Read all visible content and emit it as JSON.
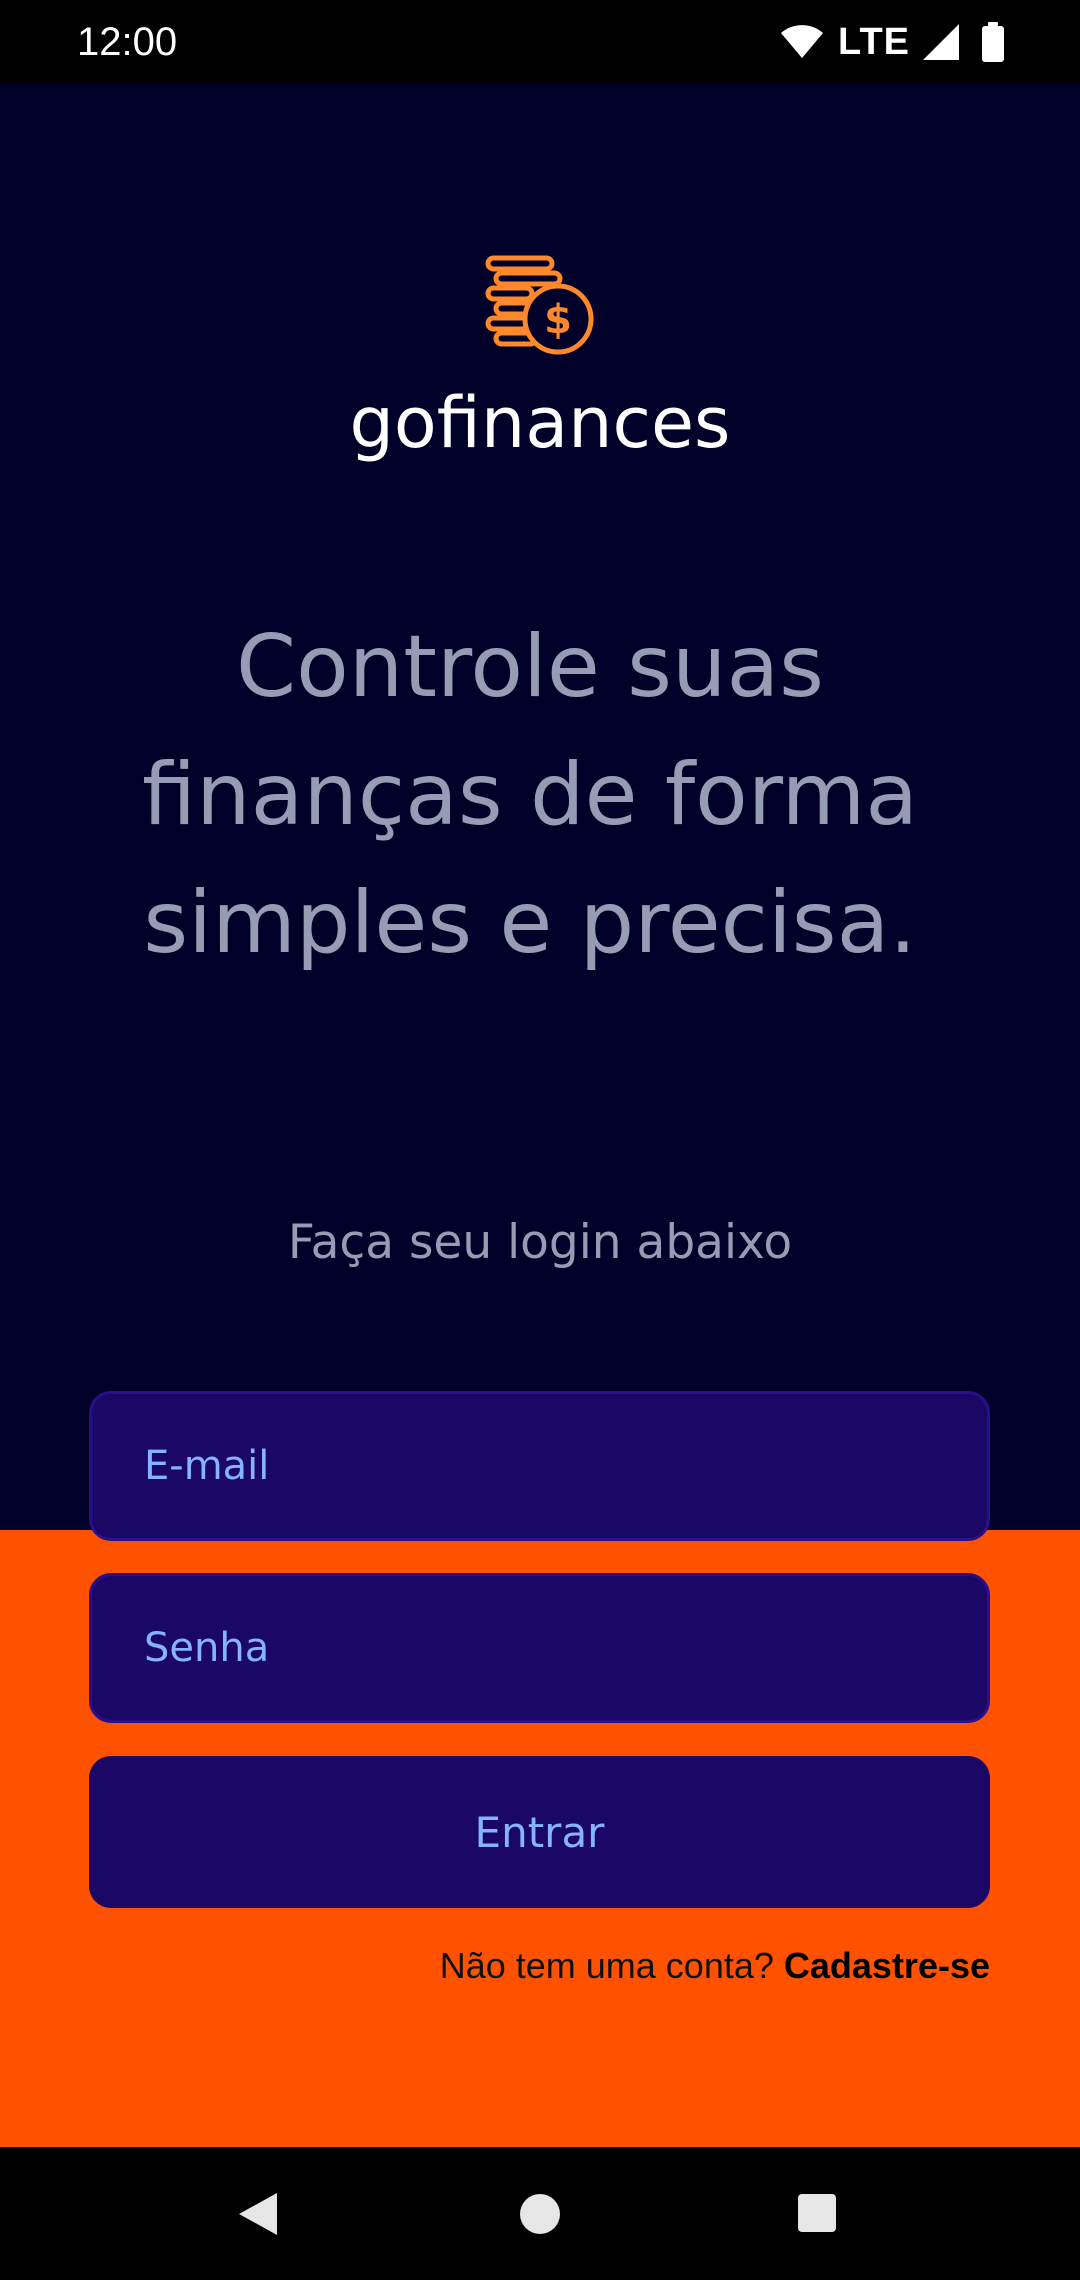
{
  "status_bar": {
    "time": "12:00",
    "network": "LTE"
  },
  "app": {
    "logo_text": "gofinances",
    "headline": "Controle suas finanças de forma simples e precisa.",
    "subtitle": "Faça seu login abaixo",
    "email_placeholder": "E-mail",
    "password_placeholder": "Senha",
    "login_button": "Entrar",
    "signup_prompt": "Não tem uma conta? ",
    "signup_link": "Cadastre-se"
  },
  "colors": {
    "background_dark": "#000028",
    "accent_orange": "#ff5201",
    "field_bg": "#1b0766",
    "placeholder": "#86b2ff",
    "headline_text": "#969cb3"
  },
  "icons": {
    "logo": "coins-dollar-icon",
    "wifi": "wifi-icon",
    "signal": "signal-icon",
    "battery": "battery-icon",
    "back": "back-triangle-icon",
    "home": "home-circle-icon",
    "recents": "recents-square-icon"
  }
}
